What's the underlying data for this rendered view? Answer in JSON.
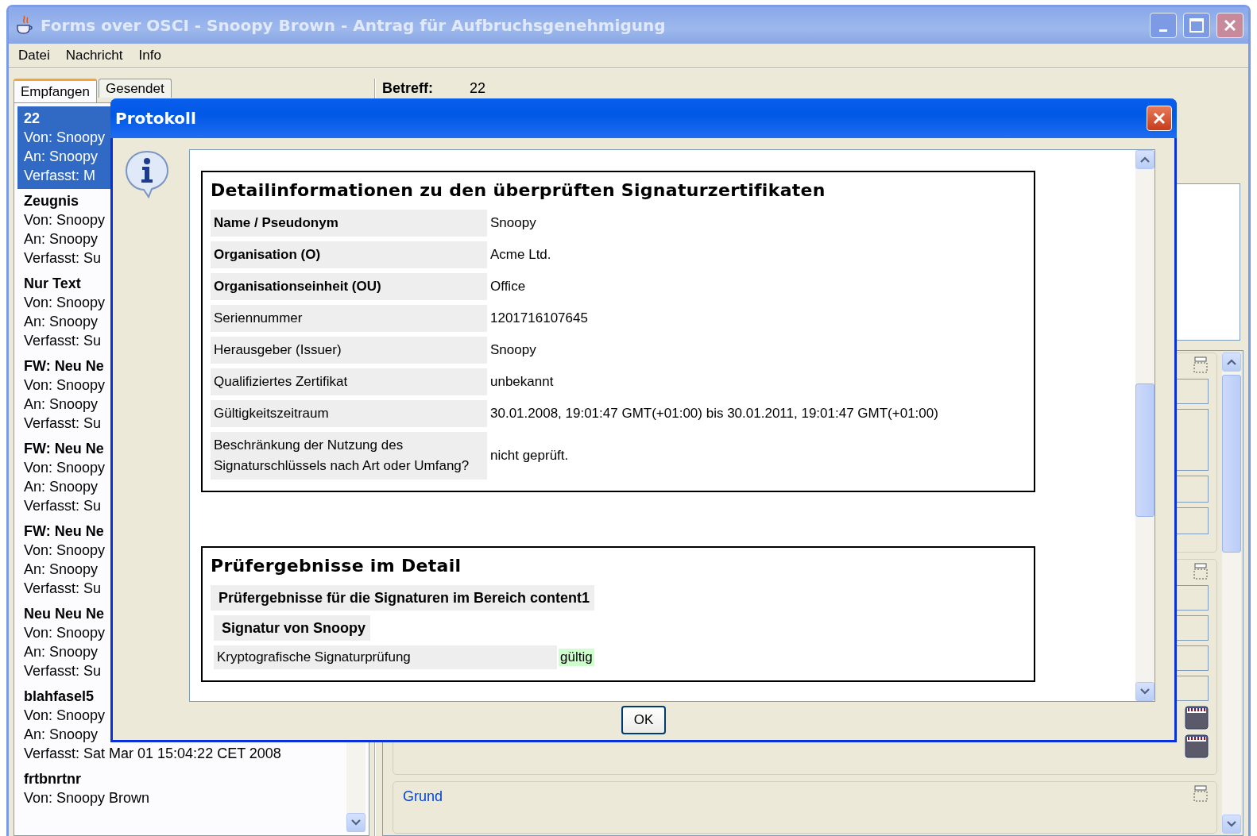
{
  "window": {
    "title": "Forms over OSCI - Snoopy Brown - Antrag für Aufbruchsgenehmigung",
    "active": false
  },
  "menu": [
    "Datei",
    "Nachricht",
    "Info"
  ],
  "tabs": [
    {
      "label": "Empfangen",
      "selected": true
    },
    {
      "label": "Gesendet",
      "selected": false
    }
  ],
  "messages": [
    {
      "subject": "22",
      "lines": [
        "Von: Snoopy",
        "An: Snoopy",
        "Verfasst: M"
      ],
      "selected": true
    },
    {
      "subject": "Zeugnis",
      "lines": [
        "Von: Snoopy",
        "An: Snoopy",
        "Verfasst: Su"
      ],
      "selected": false
    },
    {
      "subject": "Nur Text",
      "lines": [
        "Von: Snoopy",
        "An: Snoopy",
        "Verfasst: Su"
      ],
      "selected": false
    },
    {
      "subject": "FW: Neu Ne",
      "lines": [
        "Von: Snoopy",
        "An: Snoopy",
        "Verfasst: Su"
      ],
      "selected": false
    },
    {
      "subject": "FW: Neu Ne",
      "lines": [
        "Von: Snoopy",
        "An: Snoopy",
        "Verfasst: Su"
      ],
      "selected": false
    },
    {
      "subject": "FW: Neu Ne",
      "lines": [
        "Von: Snoopy",
        "An: Snoopy",
        "Verfasst: Su"
      ],
      "selected": false
    },
    {
      "subject": "Neu Neu Ne",
      "lines": [
        "Von: Snoopy",
        "An: Snoopy",
        "Verfasst: Su"
      ],
      "selected": false
    },
    {
      "subject": "blahfasel5",
      "lines": [
        "Von: Snoopy",
        "An: Snoopy",
        "Verfasst: Sat Mar 01 15:04:22 CET 2008"
      ],
      "selected": false
    },
    {
      "subject": "frtbnrtnr",
      "lines": [
        "Von: Snoopy Brown"
      ],
      "selected": false
    }
  ],
  "detail": {
    "subject_label": "Betreff:",
    "subject": "22",
    "group_label": "Grund"
  },
  "dialog": {
    "title": "Protokoll",
    "certificate": {
      "heading": "Detailinformationen zu den überprüften Signaturzertifikaten",
      "rows": [
        {
          "label": "Name / Pseudonym",
          "value": "Snoopy",
          "bold": true
        },
        {
          "label": "Organisation (O)",
          "value": "Acme Ltd.",
          "bold": true
        },
        {
          "label": "Organisationseinheit (OU)",
          "value": "Office",
          "bold": true
        },
        {
          "label": "Seriennummer",
          "value": "1201716107645",
          "bold": false
        },
        {
          "label": "Herausgeber (Issuer)",
          "value": "Snoopy",
          "bold": false
        },
        {
          "label": "Qualifiziertes Zertifikat",
          "value": "unbekannt",
          "bold": false
        },
        {
          "label": "Gültigkeitszeitraum",
          "value": "30.01.2008, 19:01:47 GMT(+01:00) bis 30.01.2011, 19:01:47 GMT(+01:00)",
          "bold": false
        },
        {
          "label": "Beschränkung der Nutzung des Signaturschlüssels nach Art oder Umfang?",
          "value": "nicht geprüft.",
          "bold": false
        }
      ]
    },
    "results": {
      "heading": "Prüfergebnisse im Detail",
      "area": "Prüfergebnisse für die Signaturen im Bereich content1",
      "signature": "Signatur von Snoopy",
      "checks": [
        {
          "label": "Kryptografische Signaturprüfung",
          "value": "gültig",
          "valid": true
        }
      ]
    },
    "button": "OK"
  }
}
